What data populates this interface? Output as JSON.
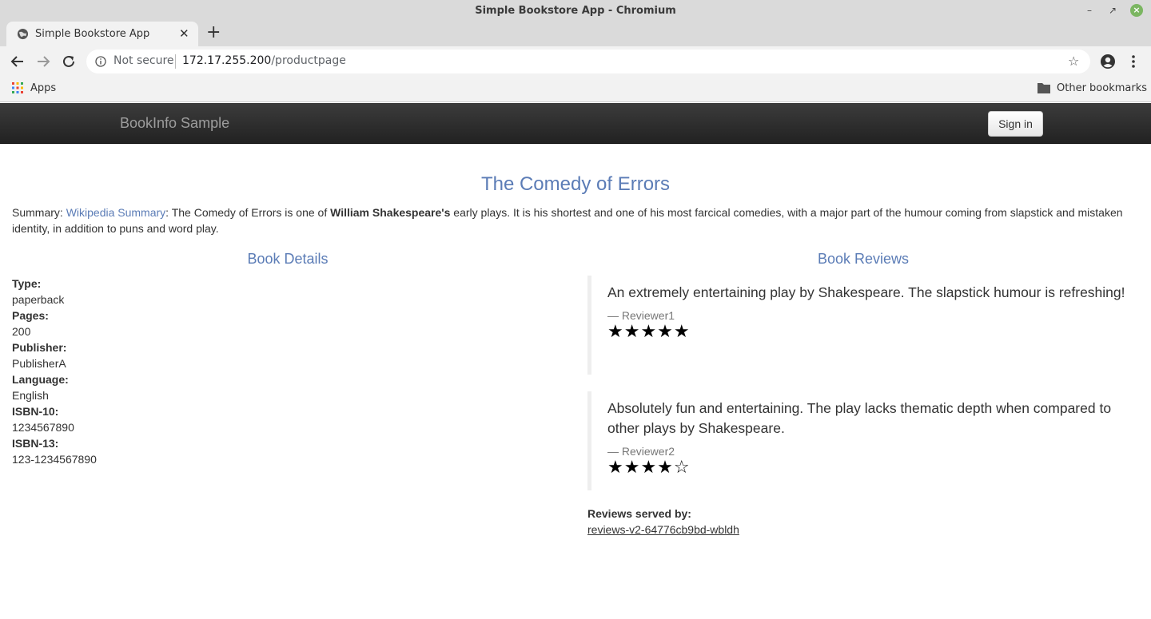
{
  "window": {
    "title": "Simple Bookstore App - Chromium"
  },
  "browser": {
    "tab_title": "Simple Bookstore App",
    "address_security": "Not secure",
    "address_host": "172.17.255.200",
    "address_path": "/productpage",
    "bookmarks": {
      "apps_label": "Apps",
      "other_label": "Other bookmarks"
    }
  },
  "navbar": {
    "brand": "BookInfo Sample",
    "signin_label": "Sign in"
  },
  "book": {
    "title": "The Comedy of Errors",
    "summary_prefix": "Summary: ",
    "summary_link": "Wikipedia Summary",
    "summary_text_1": ": The Comedy of Errors is one of ",
    "summary_bold": "William Shakespeare's",
    "summary_text_2": " early plays. It is his shortest and one of his most farcical comedies, with a major part of the humour coming from slapstick and mistaken identity, in addition to puns and word play."
  },
  "details": {
    "heading": "Book Details",
    "items": [
      {
        "key": "Type:",
        "value": "paperback"
      },
      {
        "key": "Pages:",
        "value": "200"
      },
      {
        "key": "Publisher:",
        "value": "PublisherA"
      },
      {
        "key": "Language:",
        "value": "English"
      },
      {
        "key": "ISBN-10:",
        "value": "1234567890"
      },
      {
        "key": "ISBN-13:",
        "value": "123-1234567890"
      }
    ]
  },
  "reviews": {
    "heading": "Book Reviews",
    "items": [
      {
        "text": "An extremely entertaining play by Shakespeare. The slapstick humour is refreshing!",
        "author": "— Reviewer1",
        "stars": "★★★★★",
        "rating": 5
      },
      {
        "text": "Absolutely fun and entertaining. The play lacks thematic depth when compared to other plays by Shakespeare.",
        "author": "— Reviewer2",
        "stars": "★★★★☆",
        "rating": 4
      }
    ],
    "served_label": "Reviews served by:",
    "served_value": "reviews-v2-64776cb9bd-wbldh"
  },
  "colors": {
    "link": "#5b7cb6",
    "navbar": "#222222",
    "text": "#333333"
  }
}
